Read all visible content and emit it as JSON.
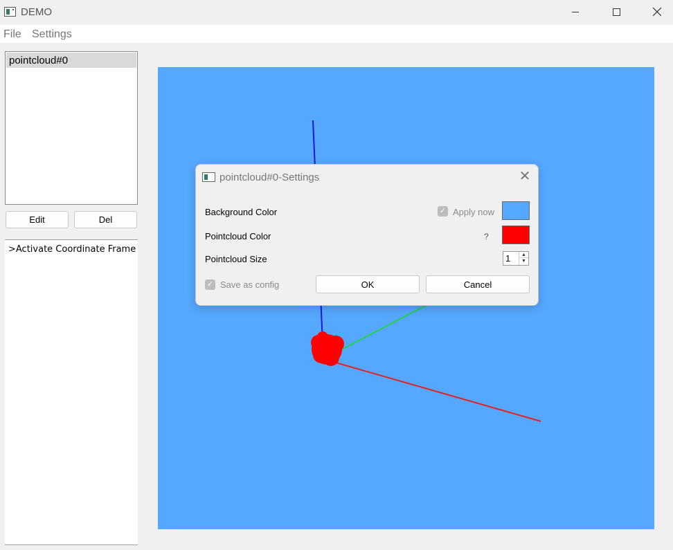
{
  "window": {
    "title": "DEMO"
  },
  "menu": {
    "file": "File",
    "settings": "Settings"
  },
  "sidebar": {
    "list_items": [
      "pointcloud#0"
    ],
    "edit_label": "Edit",
    "del_label": "Del",
    "log_lines": [
      ">Activate Coordinate Frame"
    ]
  },
  "viewer": {
    "background_color": "#56a8ff",
    "axis_colors": {
      "x": "#e8201c",
      "y": "#22d04a",
      "z": "#1a1ad6"
    },
    "pointcloud_color": "#ff0000"
  },
  "dialog": {
    "title": "pointcloud#0-Settings",
    "close_glyph": "✕",
    "background_color_label": "Background Color",
    "apply_now_label": "Apply now",
    "apply_now_checked": true,
    "pointcloud_color_label": "Pointcloud Color",
    "help_mark": "?",
    "pointcloud_size_label": "Pointcloud Size",
    "pointcloud_size_value": "1",
    "save_as_config_label": "Save as config",
    "save_as_config_checked": true,
    "ok_label": "OK",
    "cancel_label": "Cancel",
    "background_swatch": "#56a8ff",
    "pointcloud_swatch": "#ff0000"
  }
}
